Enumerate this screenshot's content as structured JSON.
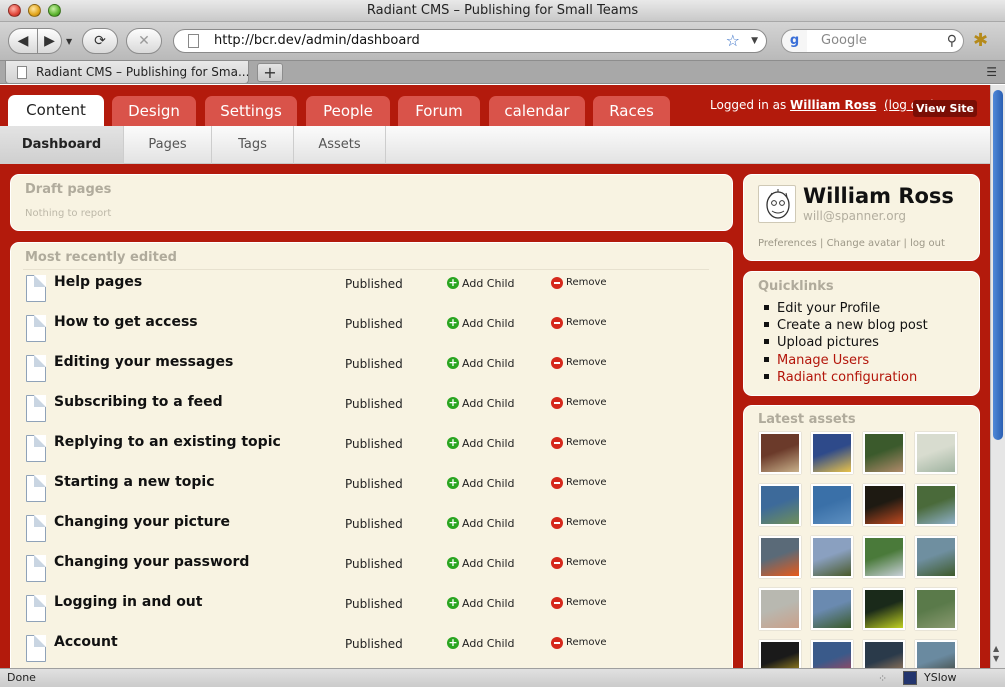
{
  "window": {
    "title": "Radiant CMS – Publishing for Small Teams"
  },
  "toolbar": {
    "url": "http://bcr.dev/admin/dashboard",
    "search_placeholder": "Google",
    "search_engine_icon": "g"
  },
  "browser_tab": {
    "title": "Radiant CMS – Publishing for Sma...",
    "new_tab": "+"
  },
  "admin_tabs": [
    "Content",
    "Design",
    "Settings",
    "People",
    "Forum",
    "calendar",
    "Races"
  ],
  "login": {
    "prefix": "Logged in as ",
    "user": "William Ross",
    "logout": "(log out)",
    "view_site": "View Site"
  },
  "sub_tabs": [
    "Dashboard",
    "Pages",
    "Tags",
    "Assets"
  ],
  "draft": {
    "title": "Draft pages",
    "empty": "Nothing to report"
  },
  "recent": {
    "title": "Most recently edited",
    "rows": [
      {
        "title": "Help pages",
        "status": "Published",
        "add": "Add Child",
        "remove": "Remove"
      },
      {
        "title": "How to get access",
        "status": "Published",
        "add": "Add Child",
        "remove": "Remove"
      },
      {
        "title": "Editing your messages",
        "status": "Published",
        "add": "Add Child",
        "remove": "Remove"
      },
      {
        "title": "Subscribing to a feed",
        "status": "Published",
        "add": "Add Child",
        "remove": "Remove"
      },
      {
        "title": "Replying to an existing topic",
        "status": "Published",
        "add": "Add Child",
        "remove": "Remove"
      },
      {
        "title": "Starting a new topic",
        "status": "Published",
        "add": "Add Child",
        "remove": "Remove"
      },
      {
        "title": "Changing your picture",
        "status": "Published",
        "add": "Add Child",
        "remove": "Remove"
      },
      {
        "title": "Changing your password",
        "status": "Published",
        "add": "Add Child",
        "remove": "Remove"
      },
      {
        "title": "Logging in and out",
        "status": "Published",
        "add": "Add Child",
        "remove": "Remove"
      },
      {
        "title": "Account",
        "status": "Published",
        "add": "Add Child",
        "remove": "Remove"
      }
    ]
  },
  "user": {
    "name": "William Ross",
    "email": "will@spanner.org",
    "links": [
      "Preferences",
      "Change avatar",
      "log out"
    ]
  },
  "quicklinks": {
    "title": "Quicklinks",
    "items": [
      {
        "label": "Edit your Profile",
        "color": "#111111"
      },
      {
        "label": "Create a new blog post",
        "color": "#111111"
      },
      {
        "label": "Upload pictures",
        "color": "#111111"
      },
      {
        "label": "Manage Users",
        "color": "#b3150a"
      },
      {
        "label": "Radiant configuration",
        "color": "#b3150a"
      }
    ]
  },
  "assets": {
    "title": "Latest assets",
    "thumbs": [
      [
        "#6b3a2a",
        "#c8b08a"
      ],
      [
        "#2e4a8a",
        "#e8c24a"
      ],
      [
        "#3b5a2c",
        "#b08a6a"
      ],
      [
        "#d8dccf",
        "#9fb3a0"
      ],
      [
        "#3d6a9a",
        "#6f8f5a"
      ],
      [
        "#3a70a8",
        "#5d8fc0"
      ],
      [
        "#1e1a12",
        "#c04a20"
      ],
      [
        "#4a6a3a",
        "#8fb0c8"
      ],
      [
        "#5a6a78",
        "#e85a1a"
      ],
      [
        "#8aa0c0",
        "#4a5a2a"
      ],
      [
        "#4a7a3a",
        "#c8d0d8"
      ],
      [
        "#6f8fa0",
        "#3e5a2a"
      ],
      [
        "#b8b8b0",
        "#caa08a"
      ],
      [
        "#6a8ab0",
        "#3a5a2a"
      ],
      [
        "#1a2a1a",
        "#c0d020"
      ],
      [
        "#5a7a4a",
        "#8a9a70"
      ],
      [
        "#1a1a1a",
        "#d0b020"
      ],
      [
        "#3a5a8a",
        "#c04050"
      ],
      [
        "#2a3a4a",
        "#c09060"
      ],
      [
        "#6a8aa0",
        "#3a3a2a"
      ]
    ]
  },
  "status": {
    "left": "Done",
    "yslow": "YSlow"
  }
}
